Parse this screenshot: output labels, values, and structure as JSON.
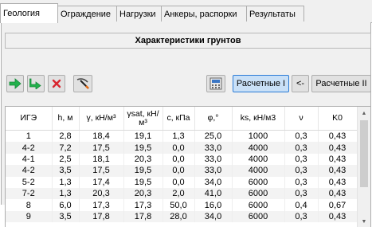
{
  "tabs": [
    {
      "label": "Геология",
      "active": true
    },
    {
      "label": "Ограждение",
      "active": false
    },
    {
      "label": "Нагрузки",
      "active": false
    },
    {
      "label": "Анкеры, распорки",
      "active": false
    },
    {
      "label": "Результаты",
      "active": false
    }
  ],
  "panel": {
    "title": "Характеристики грунтов"
  },
  "toolbar": {
    "add_icon": "arrow-right-green-icon",
    "insert_icon": "arrow-down-right-green-icon",
    "delete_icon": "red-x-icon",
    "pick_icon": "pickaxe-icon",
    "calc_icon": "calculator-icon",
    "calc1_label": "Расчетные I",
    "back_label": "<-",
    "calc2_label": "Расчетные II"
  },
  "table": {
    "columns": [
      {
        "key": "ige",
        "label": "ИГЭ"
      },
      {
        "key": "h",
        "label": "h, м"
      },
      {
        "key": "gamma",
        "label": "γ, кН/м³"
      },
      {
        "key": "gamma_sat",
        "label": "γsat, кН/м³"
      },
      {
        "key": "c",
        "label": "c, кПа"
      },
      {
        "key": "phi",
        "label": "φ,°"
      },
      {
        "key": "ks",
        "label": "ks, кН/м3"
      },
      {
        "key": "nu",
        "label": "ν"
      },
      {
        "key": "k0",
        "label": "K0"
      }
    ],
    "rows": [
      [
        "1",
        "2,8",
        "18,4",
        "19,1",
        "1,3",
        "25,0",
        "1000",
        "0,3",
        "0,43"
      ],
      [
        "4-2",
        "7,2",
        "17,5",
        "19,5",
        "0,0",
        "33,0",
        "4000",
        "0,3",
        "0,43"
      ],
      [
        "4-1",
        "2,5",
        "18,1",
        "20,3",
        "0,0",
        "33,0",
        "4000",
        "0,3",
        "0,43"
      ],
      [
        "4-2",
        "3,5",
        "17,5",
        "19,5",
        "0,0",
        "33,0",
        "4000",
        "0,3",
        "0,43"
      ],
      [
        "5-2",
        "1,3",
        "17,4",
        "19,5",
        "0,0",
        "34,0",
        "6000",
        "0,3",
        "0,43"
      ],
      [
        "7-2",
        "1,3",
        "20,3",
        "20,3",
        "2,0",
        "41,0",
        "6000",
        "0,3",
        "0,43"
      ],
      [
        "8",
        "6,0",
        "17,3",
        "17,3",
        "50,0",
        "16,0",
        "6000",
        "0,4",
        "0,67"
      ],
      [
        "9",
        "3,5",
        "17,8",
        "17,8",
        "28,0",
        "34,0",
        "6000",
        "0,3",
        "0,43"
      ]
    ]
  },
  "colors": {
    "selected_button": "#c9e0f7",
    "green_arrow": "#22b14c",
    "red_x": "#d9262f"
  }
}
